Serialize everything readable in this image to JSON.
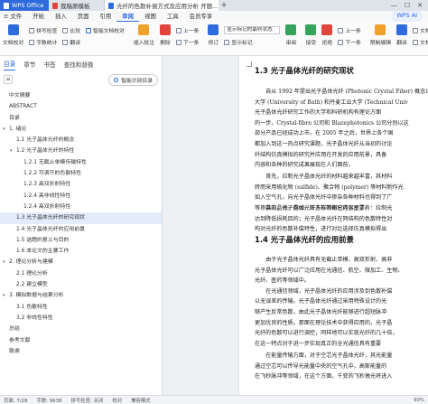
{
  "tabs": [
    {
      "label": "WPS Office"
    },
    {
      "label": "我稿原模板"
    },
    {
      "label": "光纤的色散补偿方式及应用分析 开题..."
    }
  ],
  "window_controls": [
    "—",
    "☐",
    "✕"
  ],
  "menu": {
    "items": [
      "≡ 文件",
      "开始",
      "插入",
      "页面",
      "引用",
      "审阅",
      "视图",
      "工具",
      "会员专享"
    ],
    "active_index": 5,
    "ai_label": "WPS AI"
  },
  "ribbon": {
    "doc_check": "文档校对",
    "spell_check": "拼写检查",
    "word_count": "字数统计",
    "compare": "比较",
    "translate": "翻译",
    "proofread": "智能文档校对",
    "insert_comment": "插入批注",
    "delete_comment": "删除",
    "prev": "上一条",
    "next": "下一条",
    "revise": "修订",
    "markup_select": "显示标记的最终状态",
    "show_markup": "显示标记",
    "review_pane": "审阅",
    "accept": "接受",
    "reject": "拒绝",
    "prev_change": "上一条",
    "next_change": "下一条",
    "restrict": "限制编辑",
    "doc_permission": "文档权限",
    "doc_authenticate": "文档认证",
    "translate2": "翻译",
    "icon_colors": {
      "blue": "#2f6bdc",
      "green": "#34a35b",
      "red": "#e0443c",
      "orange": "#f0a12b"
    }
  },
  "sidebar": {
    "tabs": [
      "目录",
      "章节",
      "书签",
      "查找和替换"
    ],
    "active_tab": 0,
    "smart_toc": "智能识别目录",
    "toc": [
      {
        "label": "中文摘要",
        "level": 0,
        "arrow": ""
      },
      {
        "label": "ABSTRACT",
        "level": 0,
        "arrow": ""
      },
      {
        "label": "目录",
        "level": 0,
        "arrow": ""
      },
      {
        "label": "1. 绪论",
        "level": 0,
        "arrow": "▾"
      },
      {
        "label": "1.1 光子晶体光纤的概念",
        "level": 1,
        "arrow": ""
      },
      {
        "label": "1.2 光子晶体光纤的特性",
        "level": 1,
        "arrow": "▾"
      },
      {
        "label": "1.2.1 无截止单模传输特性",
        "level": 2,
        "arrow": ""
      },
      {
        "label": "1.2.2 可调节的色散特性",
        "level": 2,
        "arrow": ""
      },
      {
        "label": "1.2.3 高双折射特性",
        "level": 2,
        "arrow": ""
      },
      {
        "label": "1.2.4 高非线性特性",
        "level": 2,
        "arrow": ""
      },
      {
        "label": "1.2.4 高双折射特性",
        "level": 2,
        "arrow": ""
      },
      {
        "label": "1.3 光子晶体光纤的研究现状",
        "level": 1,
        "arrow": "",
        "selected": true
      },
      {
        "label": "1.4 光子晶体光纤的应用前景",
        "level": 1,
        "arrow": ""
      },
      {
        "label": "1.5 选题的意义与目的",
        "level": 1,
        "arrow": ""
      },
      {
        "label": "1.6 本论文的主要工作",
        "level": 1,
        "arrow": ""
      },
      {
        "label": "2. 理论分析与建模",
        "level": 0,
        "arrow": "▾"
      },
      {
        "label": "2.1 理论分析",
        "level": 1,
        "arrow": ""
      },
      {
        "label": "2.2 建立模型",
        "level": 1,
        "arrow": ""
      },
      {
        "label": "3. 模拟数据与结果分析",
        "level": 0,
        "arrow": "▾"
      },
      {
        "label": "3.1 色散特性",
        "level": 1,
        "arrow": ""
      },
      {
        "label": "3.2 非线性特性",
        "level": 1,
        "arrow": ""
      },
      {
        "label": "总结",
        "level": 0,
        "arrow": ""
      },
      {
        "label": "参考文献",
        "level": 0,
        "arrow": ""
      },
      {
        "label": "致谢",
        "level": 0,
        "arrow": ""
      }
    ]
  },
  "document": {
    "heading1": "1.3  光子晶体光纤的研究现状",
    "para1": [
      "　　自从 1992 年提出光子晶体光纤 (Photonic Crystal Fiber) 概念以后，1996 年研制出",
      "大学 (University of Bath) 和丹麦工业大学 (Technical Univ",
      "光子晶体光纤研究工作的大学和科研机构有理论方面",
      "的一步，Crystal-fibre 公司和 Blazephotonics 公司分别以这",
      "部分产品已经成功上市。在 2005 年之后，世界上各个国",
      "都加入到这一热点研究课题，光子晶体光纤从当初的讨论",
      "纤结构仿真模拟的研究并应用在开发的应用前景，具备",
      "内容和各种的研究成果展现在人们面前。"
    ],
    "para2": [
      "　　首先，拉制光子晶体光纤的材料越来越丰富，其材料",
      "转而采用硫化物 (sulfide)、聚合物 (polymer) 等材料制作光",
      "如入空气孔，向光子晶体光纤中掺杂各种材料也得到了广",
      "等掺杂的晶体，例如，亚方形等都已经实现了。"
    ],
    "para3": [
      "　　其次，光子晶体光纤多样的研究内容主要有：拉制光",
      "达到降低损耗目的；光子晶体光纤在同结构的色散特性对",
      "构对光纤的色散补偿特性，进行对比选择仿真模拟得出"
    ],
    "heading2": "1.4  光子晶体光纤的应用前景",
    "para4": [
      "　　由于光子晶体光纤具有无截止单模、高双折射、高非",
      "光子晶体光纤可以广泛应用在光通信、航空、微加工、生物、",
      "光纤、医药等领域中。",
      "　　在光通信领域，光子晶体光纤的应用涉及到色散补偿",
      "以无误差的传输。光子晶体光纤通过采用特殊设计的光",
      "够产生反常色散，由此光子晶体光纤能够进行超短脉冲",
      "更加优良的性质。那面在理论技术中获得应用的，光子晶",
      "光纤的色散可以进行调控，同样地可以实现光纤的几十倍，",
      "在这一特点对于进一步实现真正的全光通信具有重要"
    ],
    "para5": [
      "　　在能量传输方面，对于空芯光子晶体光纤，其光能量",
      "通过空芯可以传导光能量中央的空气孔中，高斯能量的",
      "在飞秒脉冲等领域，在这个方面，千变的飞秒激光将进入"
    ]
  },
  "status": {
    "page": "页面: 7/28",
    "words": "字数: 9638",
    "spell": "拼写检查: 关闭",
    "proof": "校对",
    "compat": "兼容模式",
    "zoom": "90%"
  }
}
